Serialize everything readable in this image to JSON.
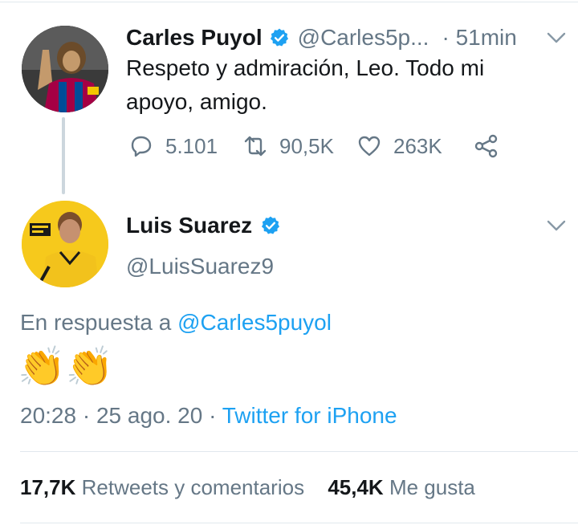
{
  "colors": {
    "accent": "#1da1f2",
    "muted": "#657786",
    "text": "#14171a",
    "divider": "#e1e8ed",
    "verified": "#1da1f2"
  },
  "tweet1": {
    "author_name": "Carles Puyol",
    "handle": "@Carles5p...",
    "time": "· 51min",
    "text": "Respeto y admiración, Leo. Todo mi apoyo, amigo.",
    "replies": "5.101",
    "retweets": "90,5K",
    "likes": "263K",
    "icons": [
      "reply-icon",
      "retweet-icon",
      "like-icon",
      "share-icon",
      "verified-icon",
      "chevron-down-icon"
    ]
  },
  "tweet2": {
    "author_name": "Luis Suarez",
    "handle": "@LuisSuarez9",
    "reply_prefix": "En respuesta a",
    "reply_to": "@Carles5puyol",
    "emoji": "👏👏",
    "timestamp": "20:28 · 25 ago. 20 ·",
    "source": "Twitter for iPhone",
    "stats": {
      "retweets_count": "17,7K",
      "retweets_label": "Retweets y comentarios",
      "likes_count": "45,4K",
      "likes_label": "Me gusta"
    }
  }
}
